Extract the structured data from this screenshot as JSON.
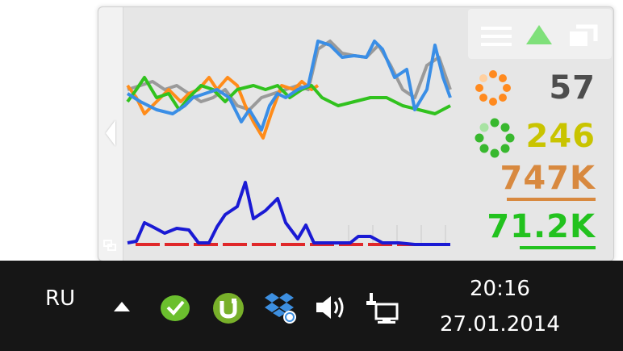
{
  "widget": {
    "stats": [
      {
        "value": "57",
        "color": "#4d4d4d",
        "ring_color": "#ff8a1f",
        "ring_icon": "orange-activity-icon"
      },
      {
        "value": "246",
        "color": "#c9c400",
        "ring_color": "#38b82e",
        "ring_icon": "green-activity-icon"
      },
      {
        "value": "747K",
        "color": "#d8893f"
      },
      {
        "value": "71.2K",
        "color": "#22c21e"
      }
    ],
    "toolbar": {
      "menu_icon": "hamburger-menu-icon",
      "arrow_icon": "up-triangle-icon",
      "window_icon": "window-restore-icon"
    },
    "collapse_icon": "collapse-left-arrow-icon"
  },
  "taskbar": {
    "language": "RU",
    "time": "20:16",
    "date": "27.01.2014",
    "icons": [
      "show-hidden-icons-arrow",
      "green-app-icon",
      "utorrent-icon",
      "dropbox-icon",
      "volume-icon",
      "network-icon"
    ]
  }
}
